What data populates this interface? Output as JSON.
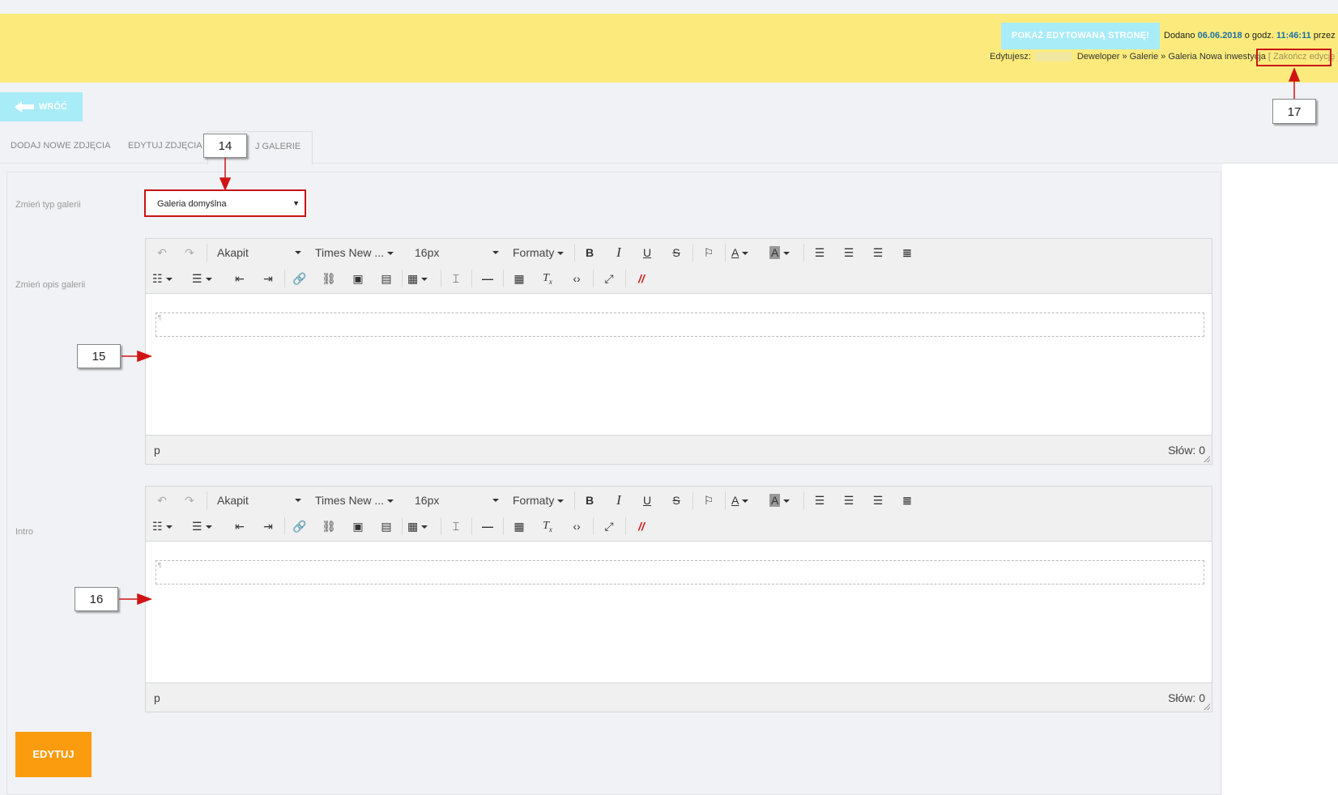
{
  "topbar": {
    "preview_button": "POKAŻ EDYTOWANĄ STRONĘ!",
    "added_prefix": "Dodano",
    "added_date": "06.06.2018",
    "added_mid": "o godz.",
    "added_time": "11:46:11",
    "added_suffix": "przez",
    "editing_label": "Edytujesz:",
    "breadcrumb": "Deweloper » Galerie » Galeria Nowa inwestycja",
    "end_edit": "[ Zakończ edycję ]"
  },
  "back_button": {
    "label": "WRÓĆ",
    "icon": "arrow-left-icon"
  },
  "tabs": [
    {
      "label": "DODAJ NOWE ZDJĘCIA"
    },
    {
      "label": "EDYTUJ ZDJĘCIA"
    },
    {
      "label": "J GALERIE"
    }
  ],
  "form": {
    "gallery_type_label": "Zmień typ galerii",
    "gallery_type_value": "Galeria domyślna",
    "description_label": "Zmień opis galerii",
    "intro_label": "Intro"
  },
  "toolbar": {
    "block_format": "Akapit",
    "font_family": "Times New ...",
    "font_size": "16px",
    "formats": "Formaty"
  },
  "editor_status": {
    "path": "p",
    "words": "Słów: 0"
  },
  "submit_button": {
    "label": "EDYTUJ"
  },
  "callouts": {
    "c14": "14",
    "c15": "15",
    "c16": "16",
    "c17": "17"
  },
  "colors": {
    "topbar": "#fceb7c",
    "light_button": "#a8ecf8",
    "submit": "#fb9c0f",
    "highlight_border": "#c81414",
    "date_link": "#1d6fa5"
  }
}
